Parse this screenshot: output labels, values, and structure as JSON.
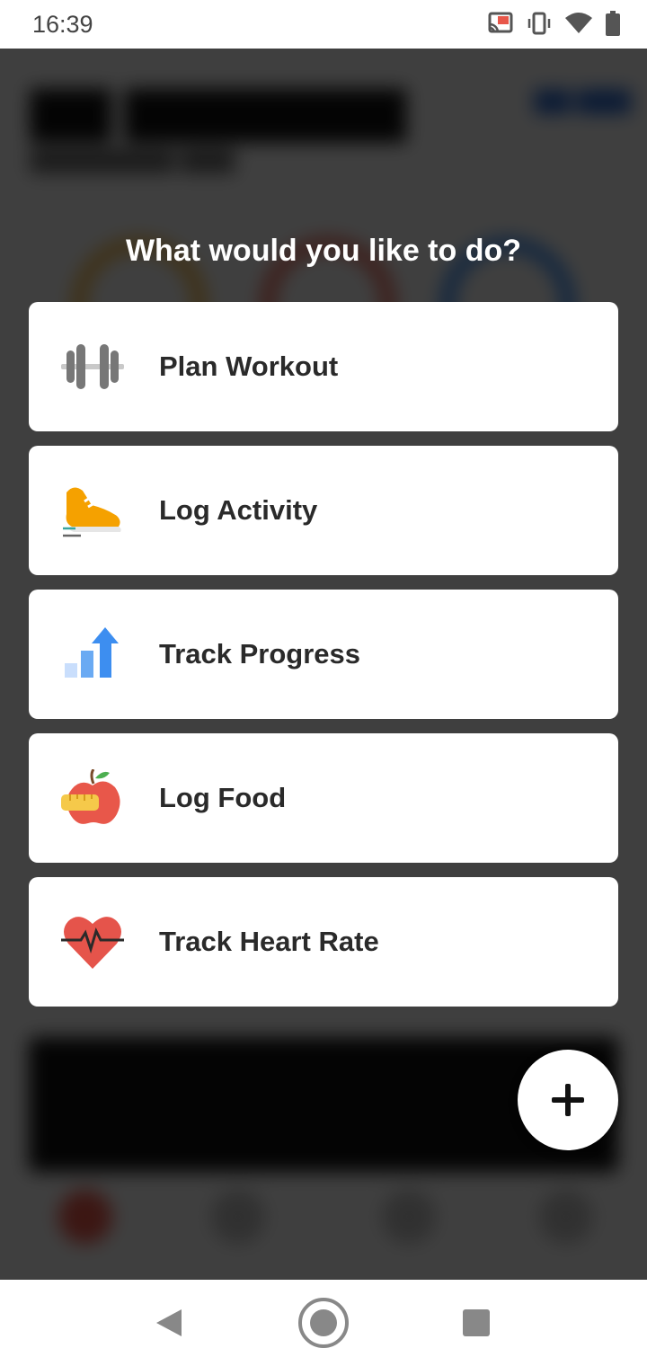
{
  "status_bar": {
    "time": "16:39",
    "icons": [
      "cast-icon",
      "vibrate-icon",
      "wifi-icon",
      "battery-icon"
    ]
  },
  "dialog": {
    "prompt": "What would you like to do?",
    "options": [
      {
        "label": "Plan Workout",
        "icon": "dumbbell-icon"
      },
      {
        "label": "Log Activity",
        "icon": "sneaker-icon"
      },
      {
        "label": "Track Progress",
        "icon": "bar-chart-arrow-icon"
      },
      {
        "label": "Log Food",
        "icon": "apple-icon"
      },
      {
        "label": "Track Heart Rate",
        "icon": "heart-pulse-icon"
      }
    ]
  },
  "fab": {
    "icon": "plus-icon"
  },
  "nav_bar": {
    "icons": [
      "back-icon",
      "home-icon",
      "recents-icon"
    ]
  },
  "colors": {
    "scrim": "#3a3a3a",
    "card": "#ffffff",
    "label_text": "#2a2a2a",
    "sneaker_orange": "#f5a100",
    "chart_blue": "#3d8ef0",
    "apple_red": "#e8574a",
    "heart_red": "#e5544b"
  }
}
